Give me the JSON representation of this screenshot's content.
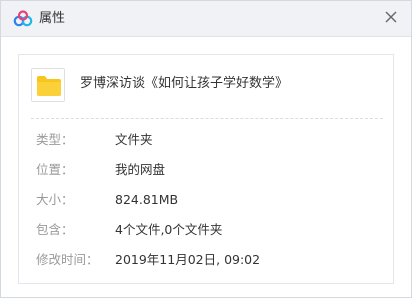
{
  "window": {
    "title": "属性",
    "logo_icon": "baidu-netdisk-cloud-icon",
    "close_icon": "close-icon"
  },
  "file": {
    "name": "罗博深访谈《如何让孩子学好数学》",
    "icon": "folder-icon",
    "icon_color": "#f8c51c"
  },
  "properties": [
    {
      "label": "类型：",
      "value": "文件夹"
    },
    {
      "label": "位置：",
      "value": "我的网盘"
    },
    {
      "label": "大小：",
      "value": "824.81MB"
    },
    {
      "label": "包含：",
      "value": "4个文件,0个文件夹"
    },
    {
      "label": "修改时间：",
      "value": "2019年11月02日, 09:02"
    }
  ],
  "colors": {
    "titlebar_bg": "#f0f2f6",
    "label_text": "#9a9a9a",
    "value_text": "#333333",
    "logo_blue": "#2f80ed",
    "logo_pink": "#e8417a"
  }
}
